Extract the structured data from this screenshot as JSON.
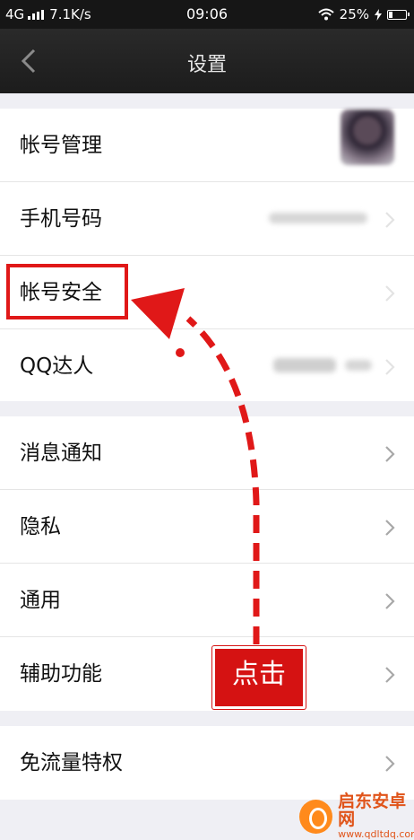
{
  "status_bar": {
    "network": "4G",
    "speed": "7.1K/s",
    "time": "09:06",
    "battery": "25%",
    "battery_level": 0.25
  },
  "header": {
    "title": "设置",
    "back_icon": "chevron-left-icon"
  },
  "settings": {
    "group1": [
      {
        "label": "帐号管理"
      },
      {
        "label": "手机号码"
      },
      {
        "label": "帐号安全"
      },
      {
        "label": "QQ达人"
      }
    ],
    "group2": [
      {
        "label": "消息通知"
      },
      {
        "label": "隐私"
      },
      {
        "label": "通用"
      },
      {
        "label": "辅助功能"
      }
    ],
    "group3": [
      {
        "label": "免流量特权"
      }
    ]
  },
  "annotation": {
    "click_label": "点击",
    "color": "#e01818"
  },
  "watermark": {
    "title": "启东安卓网",
    "url": "www.qdltdq.com"
  }
}
